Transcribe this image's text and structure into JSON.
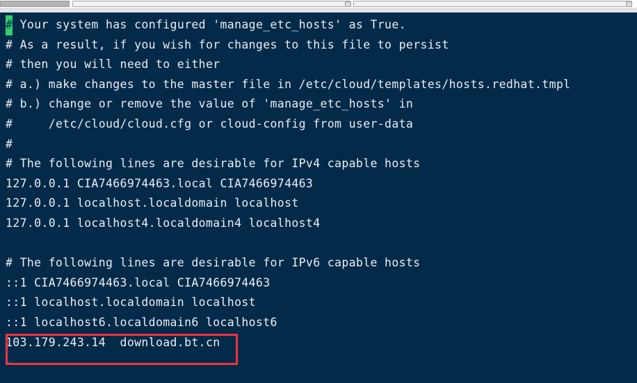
{
  "window": {
    "app_kind": "terminal-vim",
    "file": "/etc/hosts"
  },
  "colors": {
    "terminal_background": "#042a49",
    "terminal_foreground": "#e9eef2",
    "cursor_block": "#2fd16a",
    "cursor_text": "#042a49",
    "annotation_red": "#f5333f",
    "tilde_blue": "#13468c",
    "chrome_track": "#f2f2f2",
    "chrome_thumb": "#b4b4b4",
    "chrome_shade": "#dfe3e8"
  },
  "terminal": {
    "cursor": {
      "char": "#",
      "line_index": 0,
      "column_index": 0
    },
    "lines": [
      {
        "id": "line-01",
        "text": "# Your system has configured 'manage_etc_hosts' as True.",
        "has_cursor": true
      },
      {
        "id": "line-02",
        "text": "# As a result, if you wish for changes to this file to persist",
        "has_cursor": false
      },
      {
        "id": "line-03",
        "text": "# then you will need to either",
        "has_cursor": false
      },
      {
        "id": "line-04",
        "text": "# a.) make changes to the master file in /etc/cloud/templates/hosts.redhat.tmpl",
        "has_cursor": false
      },
      {
        "id": "line-05",
        "text": "# b.) change or remove the value of 'manage_etc_hosts' in",
        "has_cursor": false
      },
      {
        "id": "line-06",
        "text": "#     /etc/cloud/cloud.cfg or cloud-config from user-data",
        "has_cursor": false
      },
      {
        "id": "line-07",
        "text": "#",
        "has_cursor": false
      },
      {
        "id": "line-08",
        "text": "# The following lines are desirable for IPv4 capable hosts",
        "has_cursor": false
      },
      {
        "id": "line-09",
        "text": "127.0.0.1 CIA7466974463.local CIA7466974463",
        "has_cursor": false
      },
      {
        "id": "line-10",
        "text": "127.0.0.1 localhost.localdomain localhost",
        "has_cursor": false
      },
      {
        "id": "line-11",
        "text": "127.0.0.1 localhost4.localdomain4 localhost4",
        "has_cursor": false
      },
      {
        "id": "line-12",
        "text": "",
        "has_cursor": false
      },
      {
        "id": "line-13",
        "text": "# The following lines are desirable for IPv6 capable hosts",
        "has_cursor": false
      },
      {
        "id": "line-14",
        "text": "::1 CIA7466974463.local CIA7466974463",
        "has_cursor": false
      },
      {
        "id": "line-15",
        "text": "::1 localhost.localdomain localhost",
        "has_cursor": false
      },
      {
        "id": "line-16",
        "text": "::1 localhost6.localdomain6 localhost6",
        "has_cursor": false
      },
      {
        "id": "line-17",
        "text": "103.179.243.14  download.bt.cn",
        "has_cursor": false
      }
    ],
    "empty_markers": [
      "~"
    ]
  },
  "annotation": {
    "kind": "red-rectangle-highlight",
    "target_line": "103.179.243.14  download.bt.cn",
    "ip": "103.179.243.14",
    "hostname": "download.bt.cn"
  }
}
